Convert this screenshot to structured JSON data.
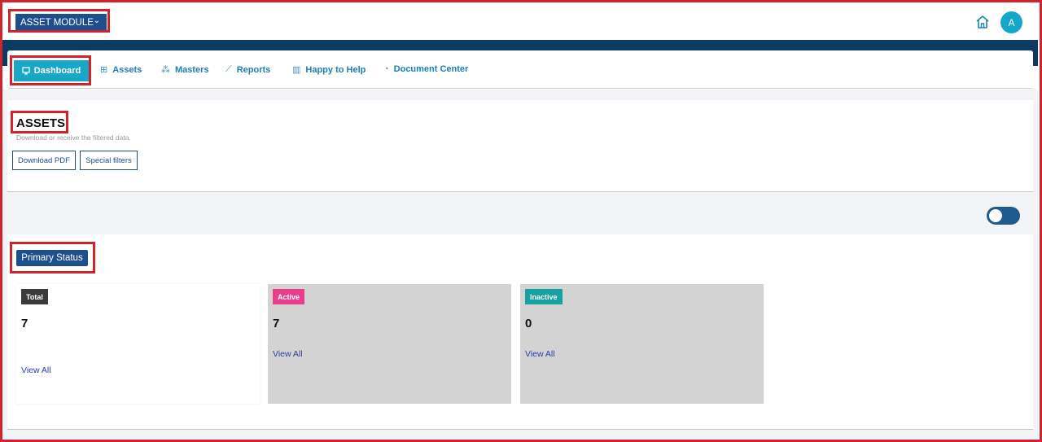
{
  "header": {
    "module_label": "ASSET MODULE",
    "module_caret": "⌄",
    "avatar_initial": "A",
    "home_icon": "home-icon"
  },
  "nav": {
    "items": [
      {
        "label": "Dashboard",
        "icon": "monitor-icon",
        "active": true
      },
      {
        "label": "Assets",
        "icon": "grid-icon"
      },
      {
        "label": "Masters",
        "icon": "hierarchy-icon"
      },
      {
        "label": "Reports",
        "icon": "chart-icon"
      },
      {
        "label": "Happy to Help",
        "icon": "book-icon"
      },
      {
        "label": "Document Center",
        "icon": "document-icon"
      }
    ]
  },
  "assets_section": {
    "title": "ASSETS",
    "subtitle": "Download or receive the filtered data.",
    "download_label": "Download PDF",
    "filters_label": "Special filters"
  },
  "status_section": {
    "title": "Primary Status",
    "tiles": [
      {
        "badge": "Total",
        "count": "7",
        "link": "View All",
        "badge_color": "#3a3a3a",
        "bg": "#ffffff"
      },
      {
        "badge": "Active",
        "count": "7",
        "link": "View All",
        "badge_color": "#e83e8c",
        "bg": "#d3d3d3"
      },
      {
        "badge": "Inactive",
        "count": "0",
        "link": "View All",
        "badge_color": "#17a2a2",
        "bg": "#d3d3d3"
      }
    ]
  },
  "colors": {
    "accent": "#1aa6c7",
    "navy": "#0d3a62",
    "highlight": "#d0232b"
  }
}
